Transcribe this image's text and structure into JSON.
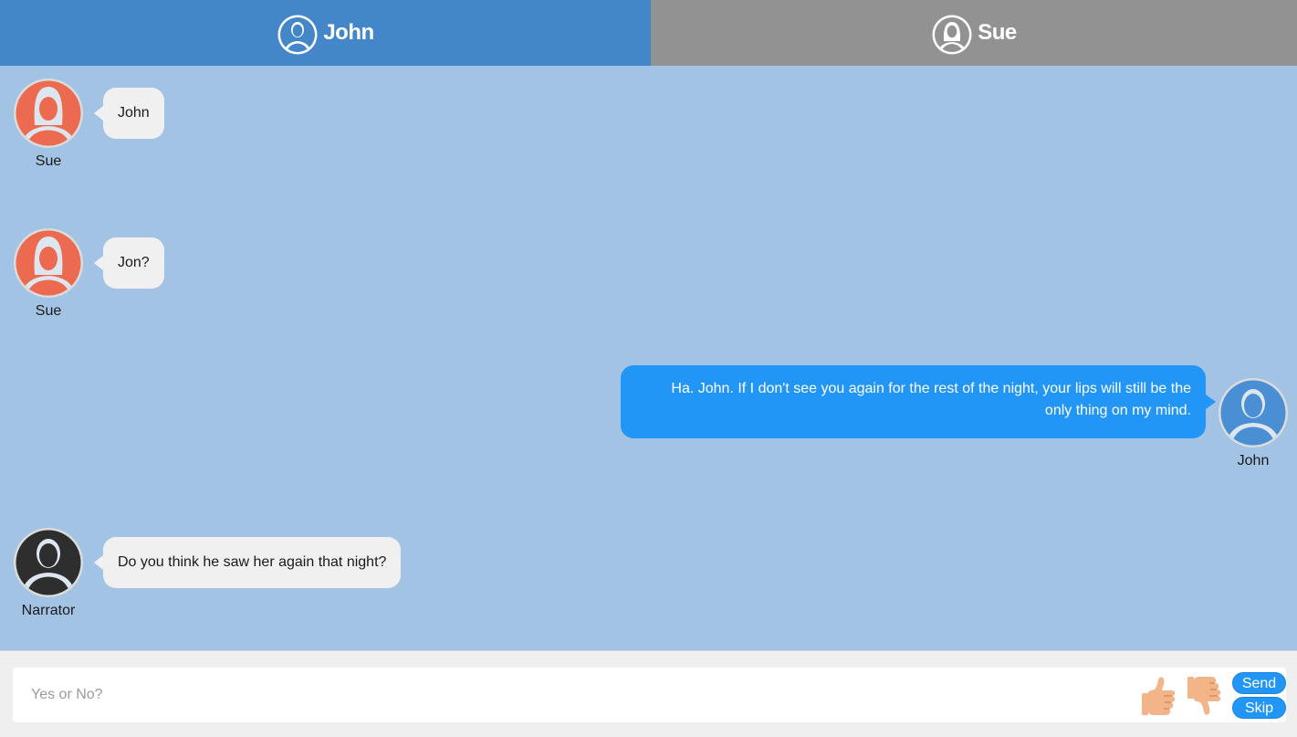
{
  "tabs": [
    {
      "label": "John",
      "color": "#4387c8"
    },
    {
      "label": "Sue",
      "color": "#929292"
    }
  ],
  "messages": [
    {
      "speaker": "Sue",
      "text": "John",
      "side": "left"
    },
    {
      "speaker": "Sue",
      "text": "Jon?",
      "side": "left"
    },
    {
      "speaker": "John",
      "text": "Ha. John. If I don't see you again for the rest of the night, your lips will still be the only thing on my mind.",
      "side": "right"
    },
    {
      "speaker": "Narrator",
      "text": "Do you think he saw her again that night?",
      "side": "left"
    }
  ],
  "composer": {
    "placeholder": "Yes or No?",
    "send_label": "Send",
    "skip_label": "Skip",
    "thumbs_up_icon": "thumbs-up-icon",
    "thumbs_down_icon": "thumbs-down-icon"
  },
  "colors": {
    "chat_background": "#a3c3e5",
    "outgoing_bubble": "#2196f6",
    "incoming_bubble": "#f0f0f0",
    "sue_avatar": "#ec6a50",
    "john_avatar": "#4a8fd4",
    "narrator_avatar": "#2e2e2e"
  }
}
